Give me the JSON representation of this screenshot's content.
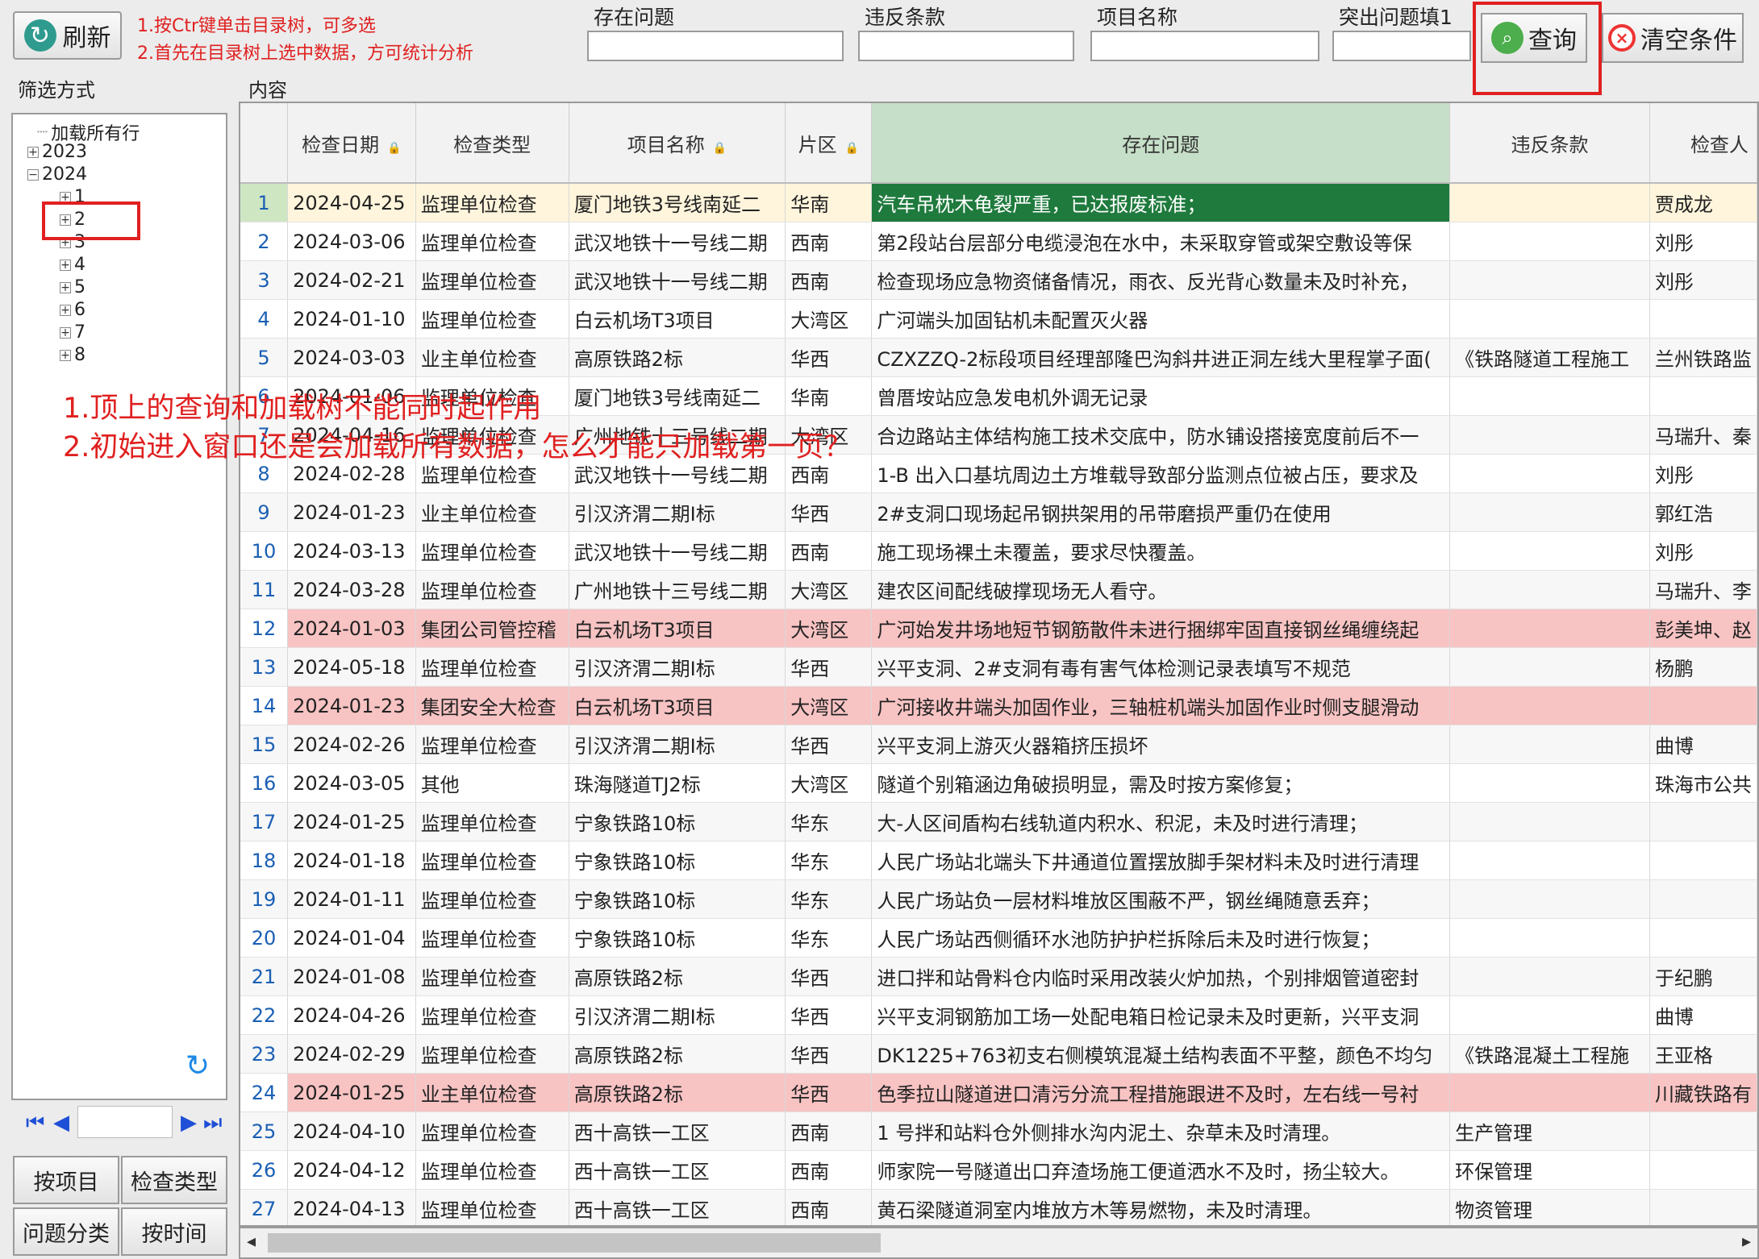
{
  "toolbar": {
    "refresh_label": "刷新",
    "refresh_icon": "refresh-icon",
    "hint_line1": "1.按Ctr键单击目录树，可多选",
    "hint_line2": "2.首先在目录树上选中数据，方可统计分析",
    "filters": [
      {
        "label": "存在问题",
        "value": ""
      },
      {
        "label": "违反条款",
        "value": ""
      },
      {
        "label": "项目名称",
        "value": ""
      },
      {
        "label": "突出问题填1",
        "value": ""
      }
    ],
    "query_label": "查询",
    "clear_label": "清空条件"
  },
  "sidebar": {
    "title": "筛选方式",
    "tree": {
      "root": "加载所有行",
      "years": [
        {
          "label": "2023",
          "expanded": false
        },
        {
          "label": "2024",
          "expanded": true,
          "children": [
            "1",
            "2",
            "3",
            "4",
            "5",
            "6",
            "7",
            "8"
          ]
        }
      ]
    },
    "buttons": [
      "按项目",
      "检查类型",
      "问题分类",
      "按时间"
    ]
  },
  "content": {
    "title": "内容"
  },
  "annotations": [
    "1.顶上的查询和加载树不能同时起作用",
    "2.初始进入窗口还是会加载所有数据，怎么才能只加载第一页？"
  ],
  "grid": {
    "columns": [
      "检查日期",
      "检查类型",
      "项目名称",
      "片区",
      "存在问题",
      "违反条款",
      "检查人"
    ],
    "locked_columns": [
      0,
      2,
      3
    ],
    "selected_column": 4,
    "rows": [
      [
        "2024-04-25",
        "监理单位检查",
        "厦门地铁3号线南延二",
        "华南",
        "汽车吊枕木龟裂严重，已达报废标准；",
        "",
        "贾成龙"
      ],
      [
        "2024-03-06",
        "监理单位检查",
        "武汉地铁十一号线二期",
        "西南",
        "第2段站台层部分电缆浸泡在水中，未采取穿管或架空敷设等保",
        "",
        "刘彤"
      ],
      [
        "2024-02-21",
        "监理单位检查",
        "武汉地铁十一号线二期",
        "西南",
        "检查现场应急物资储备情况，雨衣、反光背心数量未及时补充，",
        "",
        "刘彤"
      ],
      [
        "2024-01-10",
        "监理单位检查",
        "白云机场T3项目",
        "大湾区",
        "广河端头加固钻机未配置灭火器",
        "",
        ""
      ],
      [
        "2024-03-03",
        "业主单位检查",
        "高原铁路2标",
        "华西",
        "CZXZZQ-2标段项目经理部隆巴沟斜井进正洞左线大里程掌子面(",
        "《铁路隧道工程施工",
        "兰州铁路监"
      ],
      [
        "2024-01-06",
        "监理单位检查",
        "厦门地铁3号线南延二",
        "华南",
        "曾厝垵站应急发电机外调无记录",
        "",
        ""
      ],
      [
        "2024-04-16",
        "监理单位检查",
        "广州地铁十三号线二期",
        "大湾区",
        "合边路站主体结构施工技术交底中，防水铺设搭接宽度前后不一",
        "",
        "马瑞升、秦"
      ],
      [
        "2024-02-28",
        "监理单位检查",
        "武汉地铁十一号线二期",
        "西南",
        "1-B 出入口基坑周边土方堆载导致部分监测点位被占压，要求及",
        "",
        "刘彤"
      ],
      [
        "2024-01-23",
        "业主单位检查",
        "引汉济渭二期Ⅰ标",
        "华西",
        "2#支洞口现场起吊钢拱架用的吊带磨损严重仍在使用",
        "",
        "郭红浩"
      ],
      [
        "2024-03-13",
        "监理单位检查",
        "武汉地铁十一号线二期",
        "西南",
        "施工现场裸土未覆盖，要求尽快覆盖。",
        "",
        "刘彤"
      ],
      [
        "2024-03-28",
        "监理单位检查",
        "广州地铁十三号线二期",
        "大湾区",
        "建农区间配线破撑现场无人看守。",
        "",
        "马瑞升、李"
      ],
      [
        "2024-01-03",
        "集团公司管控稽",
        "白云机场T3项目",
        "大湾区",
        "广河始发井场地短节钢筋散件未进行捆绑牢固直接钢丝绳缠绕起",
        "",
        "彭美坤、赵"
      ],
      [
        "2024-05-18",
        "监理单位检查",
        "引汉济渭二期Ⅰ标",
        "华西",
        "兴平支洞、2#支洞有毒有害气体检测记录表填写不规范",
        "",
        "杨鹏"
      ],
      [
        "2024-01-23",
        "集团安全大检查",
        "白云机场T3项目",
        "大湾区",
        "广河接收井端头加固作业，三轴桩机端头加固作业时侧支腿滑动",
        "",
        ""
      ],
      [
        "2024-02-26",
        "监理单位检查",
        "引汉济渭二期Ⅰ标",
        "华西",
        "兴平支洞上游灭火器箱挤压损坏",
        "",
        "曲博"
      ],
      [
        "2024-03-05",
        "其他",
        "珠海隧道TJ2标",
        "大湾区",
        "隧道个别箱涵边角破损明显，需及时按方案修复；",
        "",
        "珠海市公共"
      ],
      [
        "2024-01-25",
        "监理单位检查",
        "宁象铁路10标",
        "华东",
        "大-人区间盾构右线轨道内积水、积泥，未及时进行清理；",
        "",
        ""
      ],
      [
        "2024-01-18",
        "监理单位检查",
        "宁象铁路10标",
        "华东",
        "人民广场站北端头下井通道位置摆放脚手架材料未及时进行清理",
        "",
        ""
      ],
      [
        "2024-01-11",
        "监理单位检查",
        "宁象铁路10标",
        "华东",
        "人民广场站负一层材料堆放区围蔽不严，钢丝绳随意丢弃；",
        "",
        ""
      ],
      [
        "2024-01-04",
        "监理单位检查",
        "宁象铁路10标",
        "华东",
        "人民广场站西侧循环水池防护护栏拆除后未及时进行恢复；",
        "",
        ""
      ],
      [
        "2024-01-08",
        "监理单位检查",
        "高原铁路2标",
        "华西",
        "进口拌和站骨料仓内临时采用改装火炉加热，个别排烟管道密封",
        "",
        "于纪鹏"
      ],
      [
        "2024-04-26",
        "监理单位检查",
        "引汉济渭二期Ⅰ标",
        "华西",
        "兴平支洞钢筋加工场一处配电箱日检记录未及时更新，兴平支洞",
        "",
        "曲博"
      ],
      [
        "2024-02-29",
        "监理单位检查",
        "高原铁路2标",
        "华西",
        "DK1225+763初支右侧模筑混凝土结构表面不平整，颜色不均匀",
        "《铁路混凝土工程施",
        "王亚格"
      ],
      [
        "2024-01-25",
        "业主单位检查",
        "高原铁路2标",
        "华西",
        "色季拉山隧道进口清污分流工程措施跟进不及时，左右线一号衬",
        "",
        "川藏铁路有"
      ],
      [
        "2024-04-10",
        "监理单位检查",
        "西十高铁一工区",
        "西南",
        "1 号拌和站料仓外侧排水沟内泥土、杂草未及时清理。",
        "生产管理",
        ""
      ],
      [
        "2024-04-12",
        "监理单位检查",
        "西十高铁一工区",
        "西南",
        "师家院一号隧道出口弃渣场施工便道洒水不及时，扬尘较大。",
        "环保管理",
        ""
      ],
      [
        "2024-04-13",
        "监理单位检查",
        "西十高铁一工区",
        "西南",
        "黄石梁隧道洞室内堆放方木等易燃物，未及时清理。",
        "物资管理",
        ""
      ]
    ],
    "highlighted_rows": [
      12,
      14,
      24
    ],
    "current_row": 1
  },
  "colors": {
    "accent_red": "#e02020",
    "selected_cell": "#1f7a3d",
    "highlight_row": "#f8c3c3",
    "selected_header": "#c6dfc8"
  }
}
